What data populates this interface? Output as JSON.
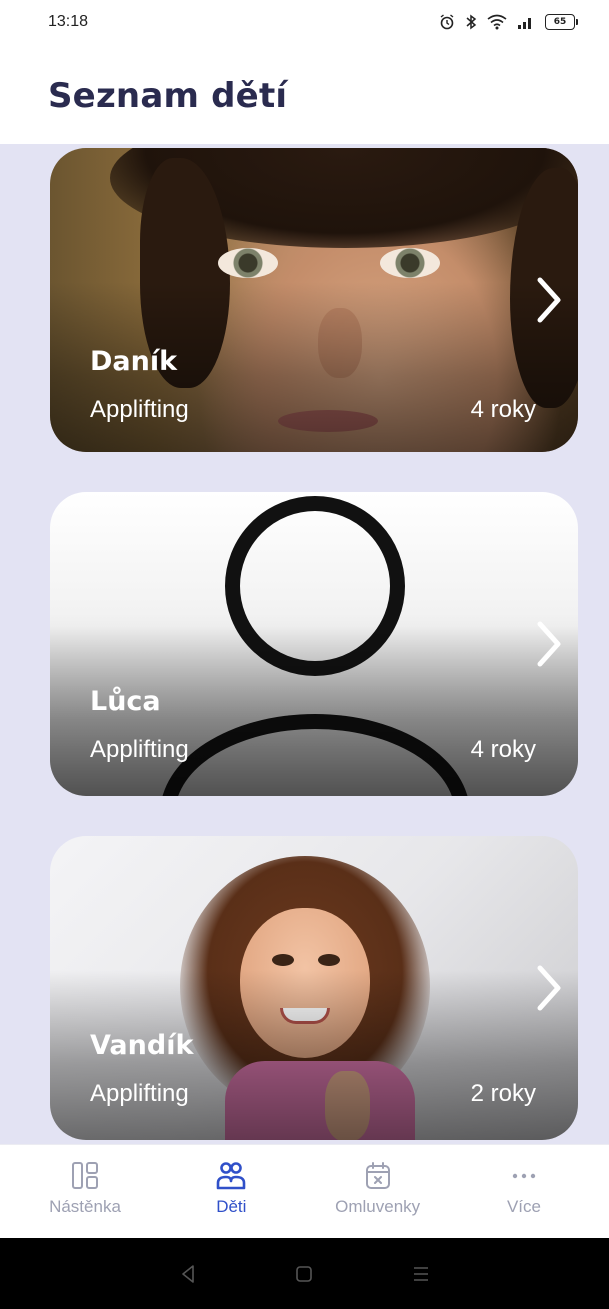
{
  "status_bar": {
    "time": "13:18",
    "battery": "65",
    "icons": [
      "alarm-icon",
      "bluetooth-icon",
      "wifi-icon",
      "signal-icon",
      "battery-icon"
    ]
  },
  "header": {
    "title": "Seznam dětí"
  },
  "children": [
    {
      "name": "Daník",
      "organization": "Applifting",
      "age": "4 roky",
      "photo": "boy-photo"
    },
    {
      "name": "Lůca",
      "organization": "Applifting",
      "age": "4 roky",
      "photo": "placeholder-avatar"
    },
    {
      "name": "Vandík",
      "organization": "Applifting",
      "age": "2 roky",
      "photo": "girl-photo"
    }
  ],
  "bottom_nav": {
    "items": [
      {
        "label": "Nástěnka",
        "icon": "dashboard-icon",
        "active": false
      },
      {
        "label": "Děti",
        "icon": "children-icon",
        "active": true
      },
      {
        "label": "Omluvenky",
        "icon": "calendar-excuse-icon",
        "active": false
      },
      {
        "label": "Více",
        "icon": "more-icon",
        "active": false
      }
    ]
  },
  "colors": {
    "title": "#2a2b4f",
    "accent": "#3050c9",
    "content_bg": "#e3e3f3",
    "nav_inactive": "#9ea1b3"
  }
}
